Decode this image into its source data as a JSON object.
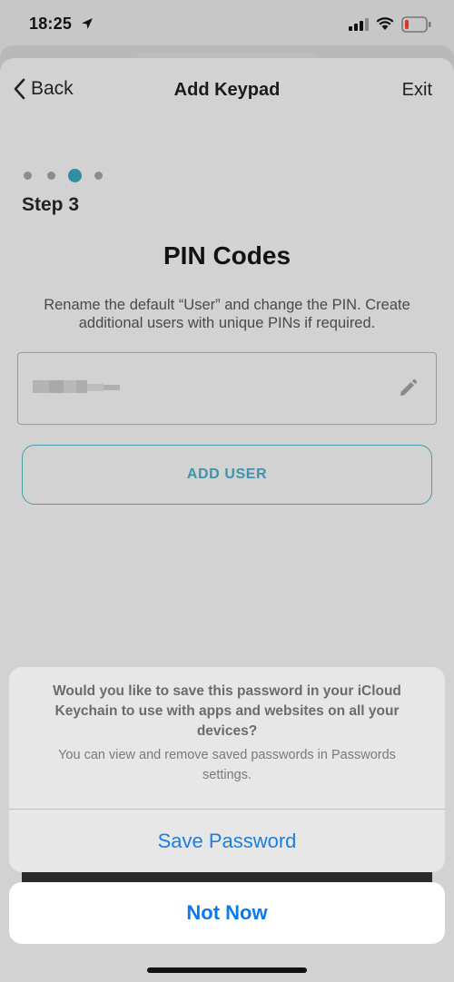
{
  "status_bar": {
    "time": "18:25"
  },
  "nav": {
    "back_label": "Back",
    "title": "Add Keypad",
    "exit_label": "Exit"
  },
  "progress": {
    "total_steps": 4,
    "current_step": 3,
    "step_label": "Step 3"
  },
  "page": {
    "title": "PIN Codes",
    "description": "Rename the default “User” and change the PIN. Create additional users with unique PINs if required."
  },
  "user_list": {
    "items": [
      {
        "name_obscured": true
      }
    ]
  },
  "add_user_label": "ADD USER",
  "save_password_prompt": {
    "message": "Would you like to save this password in your iCloud Keychain to use with apps and websites on all your devices?",
    "subtext": "You can view and remove saved passwords in Passwords settings.",
    "save_label": "Save Password",
    "cancel_label": "Not Now"
  },
  "colors": {
    "accent": "#2f8ea3",
    "ios_blue": "#1a7fe4",
    "battery_low": "#e0332b"
  }
}
